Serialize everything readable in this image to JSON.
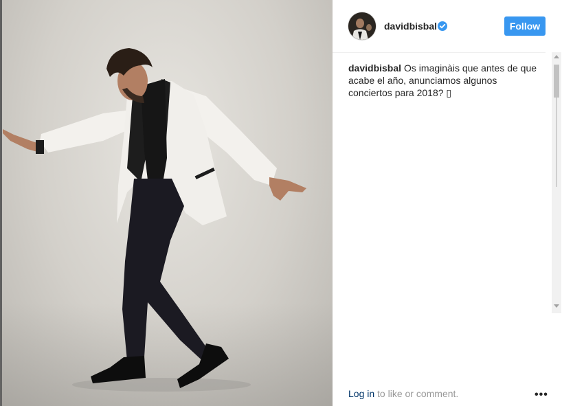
{
  "post": {
    "username": "davidbisbal",
    "follow_label": "Follow",
    "caption_text": "Os imaginàis que antes de que acabe el año, anunciamos algunos conciertos para 2018? ▯",
    "footer": {
      "login_link": "Log in",
      "rest": " to like or comment.",
      "more_glyph": "•••"
    }
  },
  "icons": {
    "verified": "verified-badge-icon",
    "more": "more-options-icon"
  },
  "colors": {
    "follow_bg": "#3897f0",
    "verified": "#3897f0",
    "link": "#003569",
    "muted": "#999999"
  }
}
